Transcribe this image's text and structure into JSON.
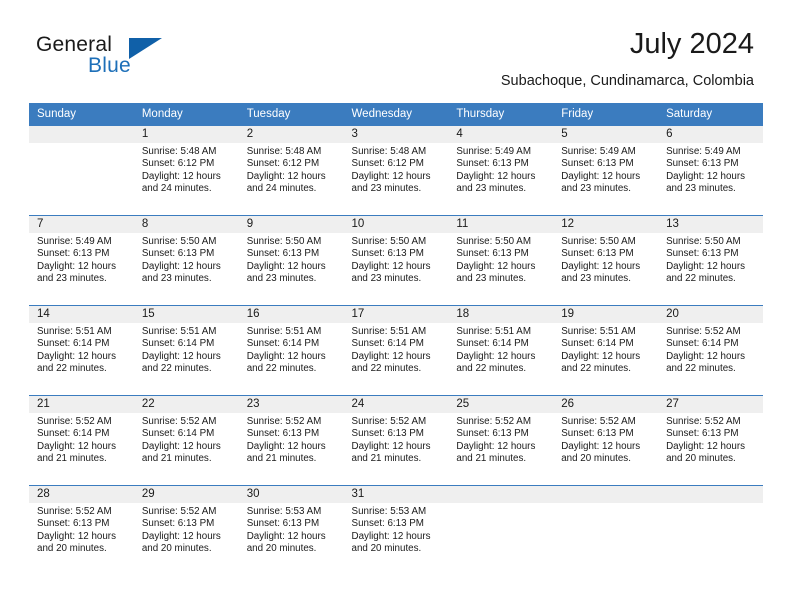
{
  "brand": {
    "name_part1": "General",
    "name_part2": "Blue",
    "accent_color": "#1060a8",
    "text_color": "#1a1a1a"
  },
  "header": {
    "title": "July 2024",
    "subtitle": "Subachoque, Cundinamarca, Colombia"
  },
  "calendar": {
    "header_bg": "#3b7cbf",
    "daynum_bg": "#efefef",
    "weekdays": [
      "Sunday",
      "Monday",
      "Tuesday",
      "Wednesday",
      "Thursday",
      "Friday",
      "Saturday"
    ],
    "weeks": [
      [
        {
          "day": "",
          "sunrise": "",
          "sunset": "",
          "daylight_line1": "",
          "daylight_line2": ""
        },
        {
          "day": "1",
          "sunrise": "Sunrise: 5:48 AM",
          "sunset": "Sunset: 6:12 PM",
          "daylight_line1": "Daylight: 12 hours",
          "daylight_line2": "and 24 minutes."
        },
        {
          "day": "2",
          "sunrise": "Sunrise: 5:48 AM",
          "sunset": "Sunset: 6:12 PM",
          "daylight_line1": "Daylight: 12 hours",
          "daylight_line2": "and 24 minutes."
        },
        {
          "day": "3",
          "sunrise": "Sunrise: 5:48 AM",
          "sunset": "Sunset: 6:12 PM",
          "daylight_line1": "Daylight: 12 hours",
          "daylight_line2": "and 23 minutes."
        },
        {
          "day": "4",
          "sunrise": "Sunrise: 5:49 AM",
          "sunset": "Sunset: 6:13 PM",
          "daylight_line1": "Daylight: 12 hours",
          "daylight_line2": "and 23 minutes."
        },
        {
          "day": "5",
          "sunrise": "Sunrise: 5:49 AM",
          "sunset": "Sunset: 6:13 PM",
          "daylight_line1": "Daylight: 12 hours",
          "daylight_line2": "and 23 minutes."
        },
        {
          "day": "6",
          "sunrise": "Sunrise: 5:49 AM",
          "sunset": "Sunset: 6:13 PM",
          "daylight_line1": "Daylight: 12 hours",
          "daylight_line2": "and 23 minutes."
        }
      ],
      [
        {
          "day": "7",
          "sunrise": "Sunrise: 5:49 AM",
          "sunset": "Sunset: 6:13 PM",
          "daylight_line1": "Daylight: 12 hours",
          "daylight_line2": "and 23 minutes."
        },
        {
          "day": "8",
          "sunrise": "Sunrise: 5:50 AM",
          "sunset": "Sunset: 6:13 PM",
          "daylight_line1": "Daylight: 12 hours",
          "daylight_line2": "and 23 minutes."
        },
        {
          "day": "9",
          "sunrise": "Sunrise: 5:50 AM",
          "sunset": "Sunset: 6:13 PM",
          "daylight_line1": "Daylight: 12 hours",
          "daylight_line2": "and 23 minutes."
        },
        {
          "day": "10",
          "sunrise": "Sunrise: 5:50 AM",
          "sunset": "Sunset: 6:13 PM",
          "daylight_line1": "Daylight: 12 hours",
          "daylight_line2": "and 23 minutes."
        },
        {
          "day": "11",
          "sunrise": "Sunrise: 5:50 AM",
          "sunset": "Sunset: 6:13 PM",
          "daylight_line1": "Daylight: 12 hours",
          "daylight_line2": "and 23 minutes."
        },
        {
          "day": "12",
          "sunrise": "Sunrise: 5:50 AM",
          "sunset": "Sunset: 6:13 PM",
          "daylight_line1": "Daylight: 12 hours",
          "daylight_line2": "and 23 minutes."
        },
        {
          "day": "13",
          "sunrise": "Sunrise: 5:50 AM",
          "sunset": "Sunset: 6:13 PM",
          "daylight_line1": "Daylight: 12 hours",
          "daylight_line2": "and 22 minutes."
        }
      ],
      [
        {
          "day": "14",
          "sunrise": "Sunrise: 5:51 AM",
          "sunset": "Sunset: 6:14 PM",
          "daylight_line1": "Daylight: 12 hours",
          "daylight_line2": "and 22 minutes."
        },
        {
          "day": "15",
          "sunrise": "Sunrise: 5:51 AM",
          "sunset": "Sunset: 6:14 PM",
          "daylight_line1": "Daylight: 12 hours",
          "daylight_line2": "and 22 minutes."
        },
        {
          "day": "16",
          "sunrise": "Sunrise: 5:51 AM",
          "sunset": "Sunset: 6:14 PM",
          "daylight_line1": "Daylight: 12 hours",
          "daylight_line2": "and 22 minutes."
        },
        {
          "day": "17",
          "sunrise": "Sunrise: 5:51 AM",
          "sunset": "Sunset: 6:14 PM",
          "daylight_line1": "Daylight: 12 hours",
          "daylight_line2": "and 22 minutes."
        },
        {
          "day": "18",
          "sunrise": "Sunrise: 5:51 AM",
          "sunset": "Sunset: 6:14 PM",
          "daylight_line1": "Daylight: 12 hours",
          "daylight_line2": "and 22 minutes."
        },
        {
          "day": "19",
          "sunrise": "Sunrise: 5:51 AM",
          "sunset": "Sunset: 6:14 PM",
          "daylight_line1": "Daylight: 12 hours",
          "daylight_line2": "and 22 minutes."
        },
        {
          "day": "20",
          "sunrise": "Sunrise: 5:52 AM",
          "sunset": "Sunset: 6:14 PM",
          "daylight_line1": "Daylight: 12 hours",
          "daylight_line2": "and 22 minutes."
        }
      ],
      [
        {
          "day": "21",
          "sunrise": "Sunrise: 5:52 AM",
          "sunset": "Sunset: 6:14 PM",
          "daylight_line1": "Daylight: 12 hours",
          "daylight_line2": "and 21 minutes."
        },
        {
          "day": "22",
          "sunrise": "Sunrise: 5:52 AM",
          "sunset": "Sunset: 6:14 PM",
          "daylight_line1": "Daylight: 12 hours",
          "daylight_line2": "and 21 minutes."
        },
        {
          "day": "23",
          "sunrise": "Sunrise: 5:52 AM",
          "sunset": "Sunset: 6:13 PM",
          "daylight_line1": "Daylight: 12 hours",
          "daylight_line2": "and 21 minutes."
        },
        {
          "day": "24",
          "sunrise": "Sunrise: 5:52 AM",
          "sunset": "Sunset: 6:13 PM",
          "daylight_line1": "Daylight: 12 hours",
          "daylight_line2": "and 21 minutes."
        },
        {
          "day": "25",
          "sunrise": "Sunrise: 5:52 AM",
          "sunset": "Sunset: 6:13 PM",
          "daylight_line1": "Daylight: 12 hours",
          "daylight_line2": "and 21 minutes."
        },
        {
          "day": "26",
          "sunrise": "Sunrise: 5:52 AM",
          "sunset": "Sunset: 6:13 PM",
          "daylight_line1": "Daylight: 12 hours",
          "daylight_line2": "and 20 minutes."
        },
        {
          "day": "27",
          "sunrise": "Sunrise: 5:52 AM",
          "sunset": "Sunset: 6:13 PM",
          "daylight_line1": "Daylight: 12 hours",
          "daylight_line2": "and 20 minutes."
        }
      ],
      [
        {
          "day": "28",
          "sunrise": "Sunrise: 5:52 AM",
          "sunset": "Sunset: 6:13 PM",
          "daylight_line1": "Daylight: 12 hours",
          "daylight_line2": "and 20 minutes."
        },
        {
          "day": "29",
          "sunrise": "Sunrise: 5:52 AM",
          "sunset": "Sunset: 6:13 PM",
          "daylight_line1": "Daylight: 12 hours",
          "daylight_line2": "and 20 minutes."
        },
        {
          "day": "30",
          "sunrise": "Sunrise: 5:53 AM",
          "sunset": "Sunset: 6:13 PM",
          "daylight_line1": "Daylight: 12 hours",
          "daylight_line2": "and 20 minutes."
        },
        {
          "day": "31",
          "sunrise": "Sunrise: 5:53 AM",
          "sunset": "Sunset: 6:13 PM",
          "daylight_line1": "Daylight: 12 hours",
          "daylight_line2": "and 20 minutes."
        },
        {
          "day": "",
          "sunrise": "",
          "sunset": "",
          "daylight_line1": "",
          "daylight_line2": ""
        },
        {
          "day": "",
          "sunrise": "",
          "sunset": "",
          "daylight_line1": "",
          "daylight_line2": ""
        },
        {
          "day": "",
          "sunrise": "",
          "sunset": "",
          "daylight_line1": "",
          "daylight_line2": ""
        }
      ]
    ]
  }
}
